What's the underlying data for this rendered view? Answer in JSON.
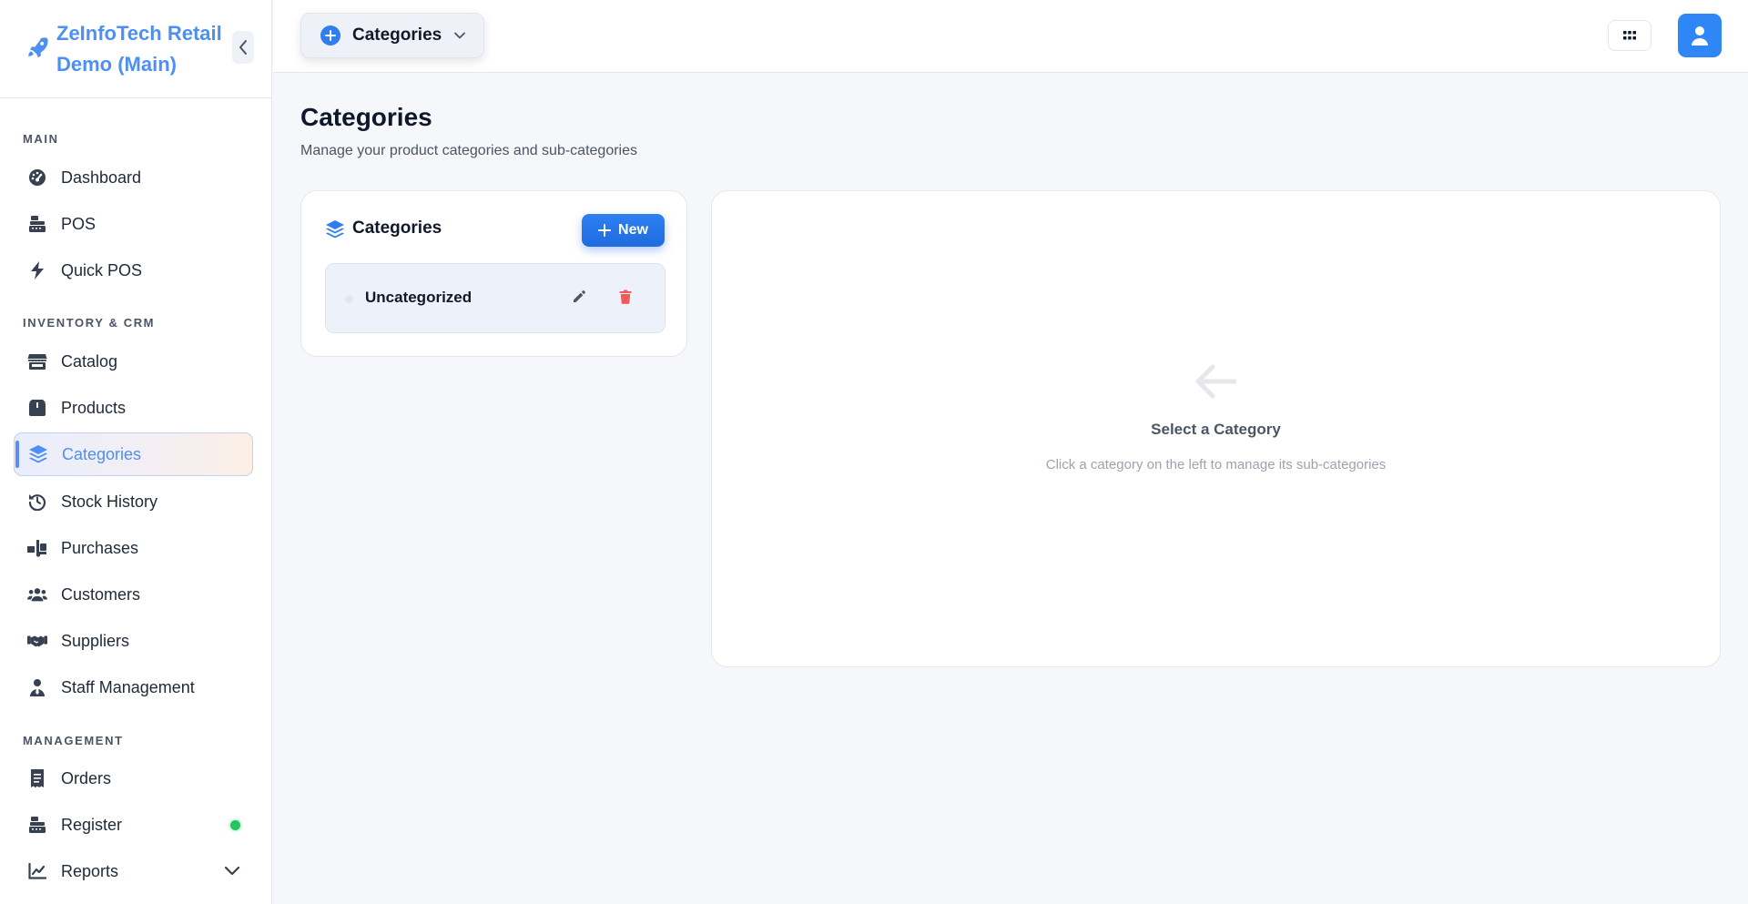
{
  "app": {
    "brand_line1": "ZeInfoTech Retail",
    "brand_line2": "Demo (Main)"
  },
  "sidebar": {
    "sections": [
      {
        "label": "MAIN",
        "items": [
          {
            "label": "Dashboard",
            "icon": "gauge-icon"
          },
          {
            "label": "POS",
            "icon": "cash-register-icon"
          },
          {
            "label": "Quick POS",
            "icon": "bolt-icon"
          }
        ]
      },
      {
        "label": "INVENTORY & CRM",
        "items": [
          {
            "label": "Catalog",
            "icon": "store-icon"
          },
          {
            "label": "Products",
            "icon": "box-icon"
          },
          {
            "label": "Categories",
            "icon": "layers-icon",
            "active": true
          },
          {
            "label": "Stock History",
            "icon": "history-icon"
          },
          {
            "label": "Purchases",
            "icon": "truck-ramp-icon"
          },
          {
            "label": "Customers",
            "icon": "users-icon"
          },
          {
            "label": "Suppliers",
            "icon": "handshake-icon"
          },
          {
            "label": "Staff Management",
            "icon": "user-tie-icon"
          }
        ]
      },
      {
        "label": "MANAGEMENT",
        "items": [
          {
            "label": "Orders",
            "icon": "receipt-icon"
          },
          {
            "label": "Register",
            "icon": "cash-register-icon",
            "status": "online"
          },
          {
            "label": "Reports",
            "icon": "line-chart-icon",
            "expandable": true
          }
        ]
      }
    ]
  },
  "topbar": {
    "page_switch_label": "Categories"
  },
  "page": {
    "title": "Categories",
    "subtitle": "Manage your product categories and sub-categories"
  },
  "category_list": {
    "title": "Categories",
    "new_button": "New",
    "items": [
      {
        "name": "Uncategorized"
      }
    ]
  },
  "detail": {
    "empty_title": "Select a Category",
    "empty_subtitle": "Click a category on the left to manage its sub-categories"
  },
  "colors": {
    "accent": "#2f7ef0",
    "brand_text": "#4d8ff2",
    "delete": "#ef5b5b",
    "status_online": "#22c55e"
  }
}
